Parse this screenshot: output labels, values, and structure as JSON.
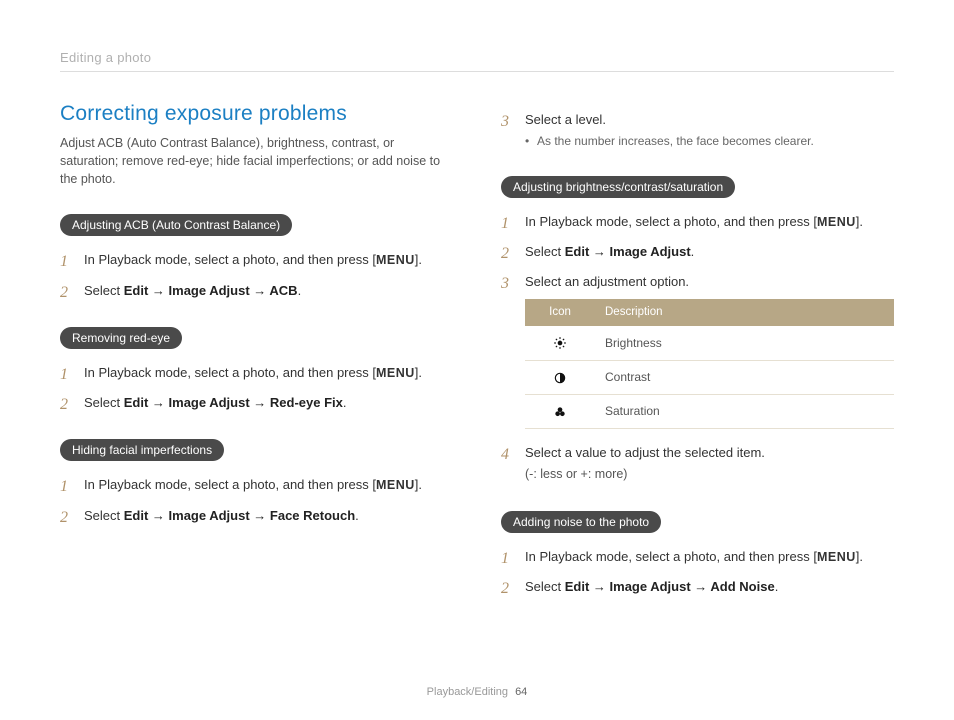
{
  "header": {
    "breadcrumb": "Editing a photo"
  },
  "title": "Correcting exposure problems",
  "intro": "Adjust ACB (Auto Contrast Balance), brightness, contrast, or saturation; remove red-eye; hide facial imperfections; or add noise to the photo.",
  "menu_key": "MENU",
  "arrow": "→",
  "left": {
    "sections": [
      {
        "pill": "Adjusting ACB (Auto Contrast Balance)",
        "steps": [
          {
            "n": "1",
            "pre": "In Playback mode, select a photo, and then press [",
            "post": "]."
          },
          {
            "n": "2",
            "pre": "Select ",
            "bold": "Edit → Image Adjust → ACB",
            "post": "."
          }
        ]
      },
      {
        "pill": "Removing red-eye",
        "steps": [
          {
            "n": "1",
            "pre": "In Playback mode, select a photo, and then press [",
            "post": "]."
          },
          {
            "n": "2",
            "pre": "Select ",
            "bold": "Edit → Image Adjust → Red-eye Fix",
            "post": "."
          }
        ]
      },
      {
        "pill": "Hiding facial imperfections",
        "steps": [
          {
            "n": "1",
            "pre": "In Playback mode, select a photo, and then press [",
            "post": "]."
          },
          {
            "n": "2",
            "pre": "Select ",
            "bold": "Edit → Image Adjust → Face Retouch",
            "post": "."
          }
        ]
      }
    ]
  },
  "right": {
    "top_steps": {
      "n3": "3",
      "text3": "Select a level.",
      "bullet": "As the number increases, the face becomes clearer."
    },
    "adjust_pill": "Adjusting brightness/contrast/saturation",
    "adjust_steps": {
      "s1": {
        "n": "1",
        "pre": "In Playback mode, select a photo, and then press [",
        "post": "]."
      },
      "s2": {
        "n": "2",
        "pre": "Select ",
        "bold": "Edit → Image Adjust",
        "post": "."
      },
      "s3": {
        "n": "3",
        "text": "Select an adjustment option."
      },
      "s4": {
        "n": "4",
        "text": "Select a value to adjust the selected item.",
        "note": "(-: less or +: more)"
      }
    },
    "table": {
      "h_icon": "Icon",
      "h_desc": "Description",
      "rows": [
        {
          "name": "brightness-icon",
          "desc": "Brightness"
        },
        {
          "name": "contrast-icon",
          "desc": "Contrast"
        },
        {
          "name": "saturation-icon",
          "desc": "Saturation"
        }
      ]
    },
    "noise_pill": "Adding noise to the photo",
    "noise_steps": {
      "s1": {
        "n": "1",
        "pre": "In Playback mode, select a photo, and then press [",
        "post": "]."
      },
      "s2": {
        "n": "2",
        "pre": "Select ",
        "bold": "Edit → Image Adjust → Add Noise",
        "post": "."
      }
    }
  },
  "footer": {
    "section": "Playback/Editing",
    "page": "64"
  }
}
